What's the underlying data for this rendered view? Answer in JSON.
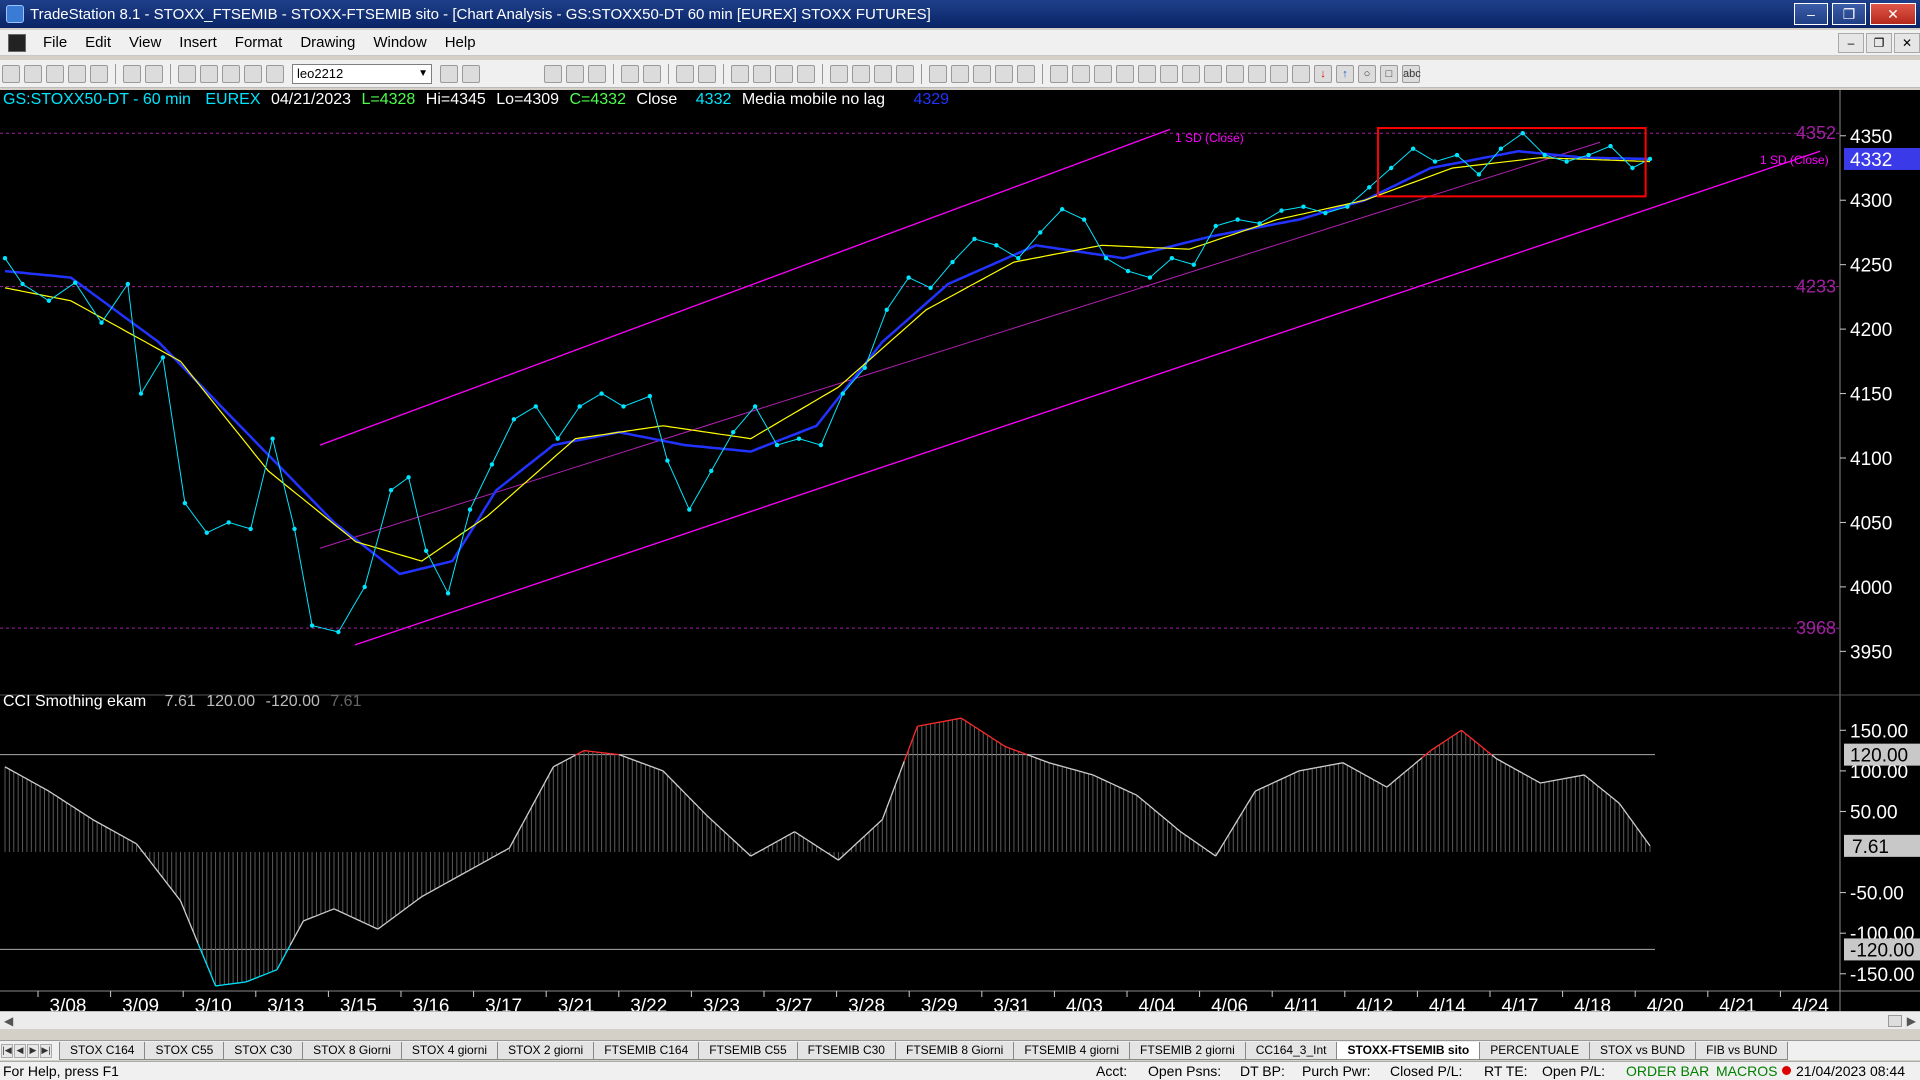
{
  "window": {
    "title": "TradeStation 8.1 - STOXX_FTSEMIB - STOXX-FTSEMIB sito - [Chart Analysis - GS:STOXX50-DT  60 min  [EUREX] STOXX FUTURES]",
    "controls": {
      "minimize": "–",
      "maximize": "❐",
      "close": "✕"
    },
    "mdi_controls": {
      "minimize": "–",
      "restore": "❐",
      "close": "✕"
    }
  },
  "menu": [
    "File",
    "Edit",
    "View",
    "Insert",
    "Format",
    "Drawing",
    "Window",
    "Help"
  ],
  "toolbar": {
    "symbol_box": "leo2212"
  },
  "chart_header": {
    "symbol": "GS:STOXX50-DT - 60 min",
    "exchange": "EUREX",
    "date": "04/21/2023",
    "last": "L=4328",
    "high": "Hi=4345",
    "low": "Lo=4309",
    "close": "C=4332",
    "close_label": "Close",
    "close_value": "4332",
    "indicator_label": "Media mobile no lag",
    "indicator_value": "4329",
    "channel_label": "1 SD (Close)"
  },
  "osc_header": {
    "name": "CCI Smothing ekam",
    "v1": "7.61",
    "v2": "120.00",
    "v3": "-120.00",
    "v4": "7.61"
  },
  "price_axis": {
    "ticks": [
      "4350",
      "4300",
      "4250",
      "4200",
      "4150",
      "4100",
      "4050",
      "4000",
      "3950"
    ],
    "current": "4332",
    "upper_marker": "4352",
    "mid_marker": "4233",
    "lower_marker": "3968"
  },
  "osc_axis": {
    "ticks": [
      "150.00",
      "100.00",
      "50.00",
      "-50.00",
      "-100.00",
      "-150.00"
    ],
    "upper_level": "120.00",
    "lower_level": "-120.00",
    "current": "7.61"
  },
  "date_axis": [
    "3/08",
    "3/09",
    "3/10",
    "3/13",
    "3/15",
    "3/16",
    "3/17",
    "3/21",
    "3/22",
    "3/23",
    "3/27",
    "3/28",
    "3/29",
    "3/31",
    "4/03",
    "4/04",
    "4/06",
    "4/11",
    "4/12",
    "4/14",
    "4/17",
    "4/18",
    "4/20",
    "4/21",
    "4/24"
  ],
  "colors": {
    "price": "#00e5ff",
    "ma_fast": "#ffff00",
    "ma_slow": "#2233ff",
    "channel": "#ff00ff",
    "highlight": "#ff0000",
    "osc_hot": "#ff2a2a",
    "osc_cold": "#00e5ff"
  },
  "chart_data": [
    {
      "type": "line",
      "title": "GS:STOXX50-DT - 60 min",
      "ylim": [
        3920,
        4370
      ],
      "x": [
        0,
        1,
        2,
        3,
        4,
        5,
        6,
        7,
        8,
        9,
        10,
        11,
        12,
        13,
        14,
        15,
        16,
        17,
        18,
        19,
        20,
        21,
        22,
        23,
        24,
        25,
        26,
        27,
        28,
        29,
        30,
        31,
        32,
        33,
        34,
        35,
        36,
        37,
        38,
        39,
        40,
        41,
        42,
        43,
        44,
        45,
        46,
        47,
        48,
        49,
        50,
        51,
        52,
        53,
        54,
        55,
        56,
        57,
        58,
        59,
        60,
        61,
        62,
        63,
        64,
        65,
        66,
        67,
        68,
        69,
        70,
        71,
        72,
        73,
        74,
        75,
        76,
        77,
        78,
        79,
        80,
        81,
        82,
        83,
        84,
        85,
        86,
        87,
        88,
        89,
        90,
        91,
        92,
        93,
        94,
        95,
        96,
        97,
        98,
        99,
        100,
        101,
        102,
        103,
        104,
        105,
        106,
        107,
        108,
        109,
        110,
        111,
        112,
        113,
        114,
        115,
        116,
        117,
        118,
        119,
        120,
        121,
        122,
        123,
        124,
        125,
        126,
        127,
        128,
        129,
        130,
        131,
        132,
        133,
        134,
        135,
        136,
        137,
        138,
        139,
        140,
        141,
        142,
        143,
        144,
        145,
        146,
        147,
        148,
        149,
        150,
        151,
        152,
        153,
        154,
        155,
        156,
        157,
        158,
        159,
        160,
        161,
        162,
        163,
        164,
        165,
        166,
        167,
        168,
        169,
        170,
        171,
        172,
        173,
        174,
        175,
        176,
        177,
        178,
        179,
        180,
        181,
        182,
        183,
        184,
        185,
        186,
        187,
        188,
        189,
        190,
        191,
        192,
        193,
        194,
        195,
        196,
        197,
        198,
        199,
        200,
        201,
        202,
        203,
        204,
        205,
        206,
        207,
        208,
        209,
        210,
        211,
        212,
        213,
        214,
        215,
        216,
        217,
        218,
        219,
        220,
        221,
        222,
        223,
        224,
        225,
        226,
        227,
        228,
        229,
        230,
        231,
        232,
        233,
        234,
        235,
        236,
        237,
        238,
        239,
        240,
        241,
        242,
        243,
        244,
        245,
        246,
        247,
        248,
        249,
        250,
        251,
        252,
        253,
        254,
        255,
        256,
        257,
        258,
        259,
        260,
        261,
        262,
        263,
        264,
        265,
        266,
        267,
        268,
        269,
        270,
        271,
        272,
        273,
        274,
        275,
        276,
        277,
        278,
        279,
        280,
        281,
        282,
        283,
        284,
        285,
        286,
        287,
        288,
        289,
        290,
        291,
        292,
        293,
        294,
        295,
        296,
        297,
        298,
        299,
        300,
        301,
        302,
        303,
        304,
        305,
        306,
        307,
        308,
        309,
        310,
        311,
        312,
        313,
        314,
        315,
        316,
        317,
        318,
        319,
        320,
        321,
        322,
        323,
        324,
        325,
        326,
        327,
        328,
        329,
        330,
        331,
        332,
        333,
        334,
        335,
        336,
        337,
        338,
        339,
        340,
        341,
        342,
        343,
        344,
        345,
        346,
        347,
        348,
        349,
        350,
        351,
        352,
        353,
        354,
        355,
        356,
        357,
        358,
        359,
        360,
        361,
        362,
        363,
        364,
        365,
        366,
        367,
        368,
        369,
        370,
        371,
        372,
        373,
        374,
        375
      ],
      "series": [
        {
          "name": "Close",
          "anchors": [
            [
              0,
              4255
            ],
            [
              4,
              4235
            ],
            [
              10,
              4222
            ],
            [
              16,
              4236
            ],
            [
              22,
              4205
            ],
            [
              28,
              4235
            ],
            [
              31,
              4150
            ],
            [
              36,
              4178
            ],
            [
              41,
              4065
            ],
            [
              46,
              4042
            ],
            [
              51,
              4050
            ],
            [
              56,
              4045
            ],
            [
              61,
              4115
            ],
            [
              66,
              4045
            ],
            [
              70,
              3970
            ],
            [
              76,
              3965
            ],
            [
              82,
              4000
            ],
            [
              88,
              4075
            ],
            [
              92,
              4085
            ],
            [
              96,
              4028
            ],
            [
              101,
              3995
            ],
            [
              106,
              4060
            ],
            [
              111,
              4095
            ],
            [
              116,
              4130
            ],
            [
              121,
              4140
            ],
            [
              126,
              4115
            ],
            [
              131,
              4140
            ],
            [
              136,
              4150
            ],
            [
              141,
              4140
            ],
            [
              147,
              4148
            ],
            [
              151,
              4098
            ],
            [
              156,
              4060
            ],
            [
              161,
              4090
            ],
            [
              166,
              4120
            ],
            [
              171,
              4140
            ],
            [
              176,
              4110
            ],
            [
              181,
              4115
            ],
            [
              186,
              4110
            ],
            [
              191,
              4150
            ],
            [
              196,
              4170
            ],
            [
              201,
              4215
            ],
            [
              206,
              4240
            ],
            [
              211,
              4232
            ],
            [
              216,
              4252
            ],
            [
              221,
              4270
            ],
            [
              226,
              4265
            ],
            [
              231,
              4255
            ],
            [
              236,
              4275
            ],
            [
              241,
              4293
            ],
            [
              246,
              4285
            ],
            [
              251,
              4255
            ],
            [
              256,
              4245
            ],
            [
              261,
              4240
            ],
            [
              266,
              4255
            ],
            [
              271,
              4250
            ],
            [
              276,
              4280
            ],
            [
              281,
              4285
            ],
            [
              286,
              4282
            ],
            [
              291,
              4292
            ],
            [
              296,
              4295
            ],
            [
              301,
              4290
            ],
            [
              306,
              4295
            ],
            [
              311,
              4310
            ],
            [
              316,
              4325
            ],
            [
              321,
              4340
            ],
            [
              326,
              4330
            ],
            [
              331,
              4335
            ],
            [
              336,
              4320
            ],
            [
              341,
              4340
            ],
            [
              346,
              4352
            ],
            [
              351,
              4335
            ],
            [
              356,
              4330
            ],
            [
              361,
              4335
            ],
            [
              366,
              4342
            ],
            [
              371,
              4325
            ],
            [
              375,
              4332
            ]
          ]
        },
        {
          "name": "Media mobile no lag",
          "anchors": [
            [
              0,
              4232
            ],
            [
              15,
              4222
            ],
            [
              40,
              4175
            ],
            [
              60,
              4090
            ],
            [
              80,
              4035
            ],
            [
              95,
              4020
            ],
            [
              110,
              4055
            ],
            [
              130,
              4115
            ],
            [
              150,
              4125
            ],
            [
              170,
              4115
            ],
            [
              190,
              4155
            ],
            [
              210,
              4215
            ],
            [
              230,
              4252
            ],
            [
              250,
              4265
            ],
            [
              270,
              4262
            ],
            [
              290,
              4285
            ],
            [
              310,
              4300
            ],
            [
              330,
              4325
            ],
            [
              350,
              4333
            ],
            [
              375,
              4330
            ]
          ]
        },
        {
          "name": "",
          "anchors": [
            [
              0,
              4245
            ],
            [
              15,
              4240
            ],
            [
              35,
              4190
            ],
            [
              55,
              4120
            ],
            [
              75,
              4050
            ],
            [
              90,
              4010
            ],
            [
              102,
              4020
            ],
            [
              112,
              4075
            ],
            [
              125,
              4110
            ],
            [
              140,
              4120
            ],
            [
              155,
              4110
            ],
            [
              170,
              4105
            ],
            [
              185,
              4125
            ],
            [
              200,
              4190
            ],
            [
              215,
              4235
            ],
            [
              235,
              4265
            ],
            [
              255,
              4255
            ],
            [
              275,
              4272
            ],
            [
              295,
              4285
            ],
            [
              310,
              4300
            ],
            [
              325,
              4325
            ],
            [
              345,
              4338
            ],
            [
              360,
              4333
            ],
            [
              375,
              4332
            ]
          ]
        }
      ]
    },
    {
      "type": "line",
      "title": "CCI Smothing ekam",
      "ylim": [
        -170,
        175
      ],
      "x": [
        0,
        375
      ],
      "levels": [
        120,
        -120
      ],
      "series": [
        {
          "name": "CCI Smothing ekam",
          "anchors": [
            [
              0,
              105
            ],
            [
              10,
              75
            ],
            [
              20,
              40
            ],
            [
              30,
              10
            ],
            [
              40,
              -60
            ],
            [
              48,
              -165
            ],
            [
              55,
              -160
            ],
            [
              62,
              -145
            ],
            [
              68,
              -85
            ],
            [
              75,
              -70
            ],
            [
              85,
              -95
            ],
            [
              95,
              -55
            ],
            [
              105,
              -25
            ],
            [
              115,
              5
            ],
            [
              125,
              105
            ],
            [
              132,
              125
            ],
            [
              140,
              120
            ],
            [
              150,
              100
            ],
            [
              160,
              45
            ],
            [
              170,
              -5
            ],
            [
              180,
              25
            ],
            [
              190,
              -10
            ],
            [
              200,
              40
            ],
            [
              208,
              155
            ],
            [
              218,
              165
            ],
            [
              228,
              130
            ],
            [
              238,
              110
            ],
            [
              248,
              95
            ],
            [
              258,
              70
            ],
            [
              268,
              25
            ],
            [
              276,
              -5
            ],
            [
              285,
              75
            ],
            [
              295,
              100
            ],
            [
              305,
              110
            ],
            [
              315,
              80
            ],
            [
              325,
              125
            ],
            [
              332,
              150
            ],
            [
              340,
              115
            ],
            [
              350,
              85
            ],
            [
              360,
              95
            ],
            [
              368,
              60
            ],
            [
              375,
              7.61
            ]
          ]
        }
      ]
    }
  ],
  "tabs": [
    "STOX C164",
    "STOX C55",
    "STOX  C30",
    "STOX  8 Giorni",
    "STOX 4 giorni",
    "STOX  2 giorni",
    "FTSEMIB C164",
    "FTSEMIB C55",
    "FTSEMIB C30",
    "FTSEMIB  8 Giorni",
    "FTSEMIB  4 giorni",
    "FTSEMIB  2 giorni",
    "CC164_3_Int",
    "STOXX-FTSEMIB sito",
    "PERCENTUALE",
    "STOX vs BUND",
    "FIB vs BUND"
  ],
  "active_tab": "STOXX-FTSEMIB sito",
  "status": {
    "help": "For Help, press F1",
    "acct": "Acct:",
    "open_psns": "Open Psns:",
    "dt_bp": "DT BP:",
    "purch_pwr": "Purch Pwr:",
    "closed_pl": "Closed P/L:",
    "rt_te": "RT TE:",
    "open_pl": "Open P/L:",
    "order_bar": "ORDER BAR",
    "macros": "MACROS",
    "datetime": "21/04/2023 08:44"
  }
}
